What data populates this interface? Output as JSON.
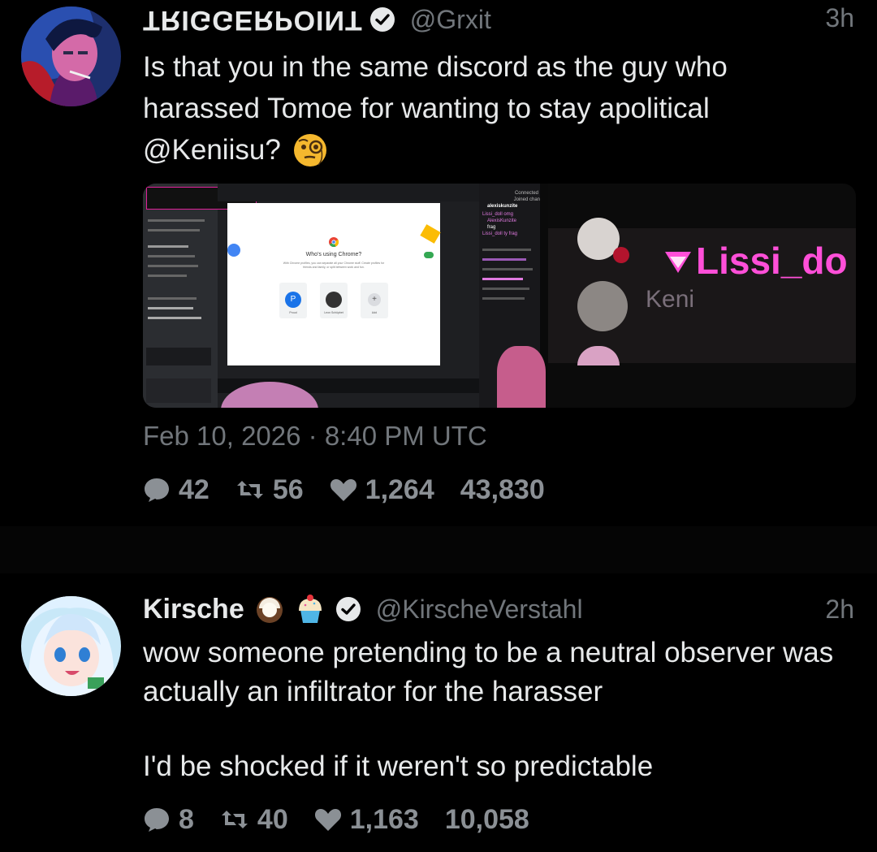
{
  "tweets": [
    {
      "display_name": "TRIGGERPOINT",
      "handle": "@Grxit",
      "time": "3h",
      "text_line1": "Is that you in the same discord as the guy who",
      "text_line2": "harassed Tomoe for wanting to stay apolitical",
      "text_line3": "@Keniisu?",
      "text_emoji": "face-with-monocle",
      "date": "Feb 10, 2026 · 8:40 PM UTC",
      "replies": "42",
      "retweets": "56",
      "likes": "1,264",
      "views": "43,830",
      "media": {
        "screenshot_title": "Who's using Chrome?",
        "screenshot_subtitle": "With Chrome profiles, you can separate all your Chrome stuff. Create profiles for friends and family, or split between work and fun.",
        "profile_1_label": "Proud",
        "profile_2_label": "Leon Schüpbet",
        "profile_add_label": "Add",
        "zoom_name_1": "Lissi_do",
        "zoom_name_2": "Keni",
        "chat_header": "Connected",
        "chat_joined": "Joined chan",
        "chat_user": "alexiskunzite",
        "chat_msg_1": "Lissi_doll omg",
        "chat_msg_2": "AlexisKunzite",
        "chat_msg_3": "frag",
        "chat_msg_4": "Lissi_doll ty frag"
      }
    },
    {
      "display_name": "Kirsche",
      "handle": "@KirscheVerstahl",
      "time": "2h",
      "text_line1": "wow someone pretending to be a neutral observer was",
      "text_line2": "actually an infiltrator for the harasser",
      "text_line3": "I'd be shocked if it weren't so predictable",
      "name_emojis": [
        "coconut",
        "cupcake"
      ],
      "replies": "8",
      "retweets": "40",
      "likes": "1,163",
      "views": "10,058"
    }
  ],
  "colors": {
    "background": "#000000",
    "text": "#e7e9ea",
    "muted": "#71767b",
    "stat": "#8b9095",
    "verified": "#e7e9ea"
  }
}
